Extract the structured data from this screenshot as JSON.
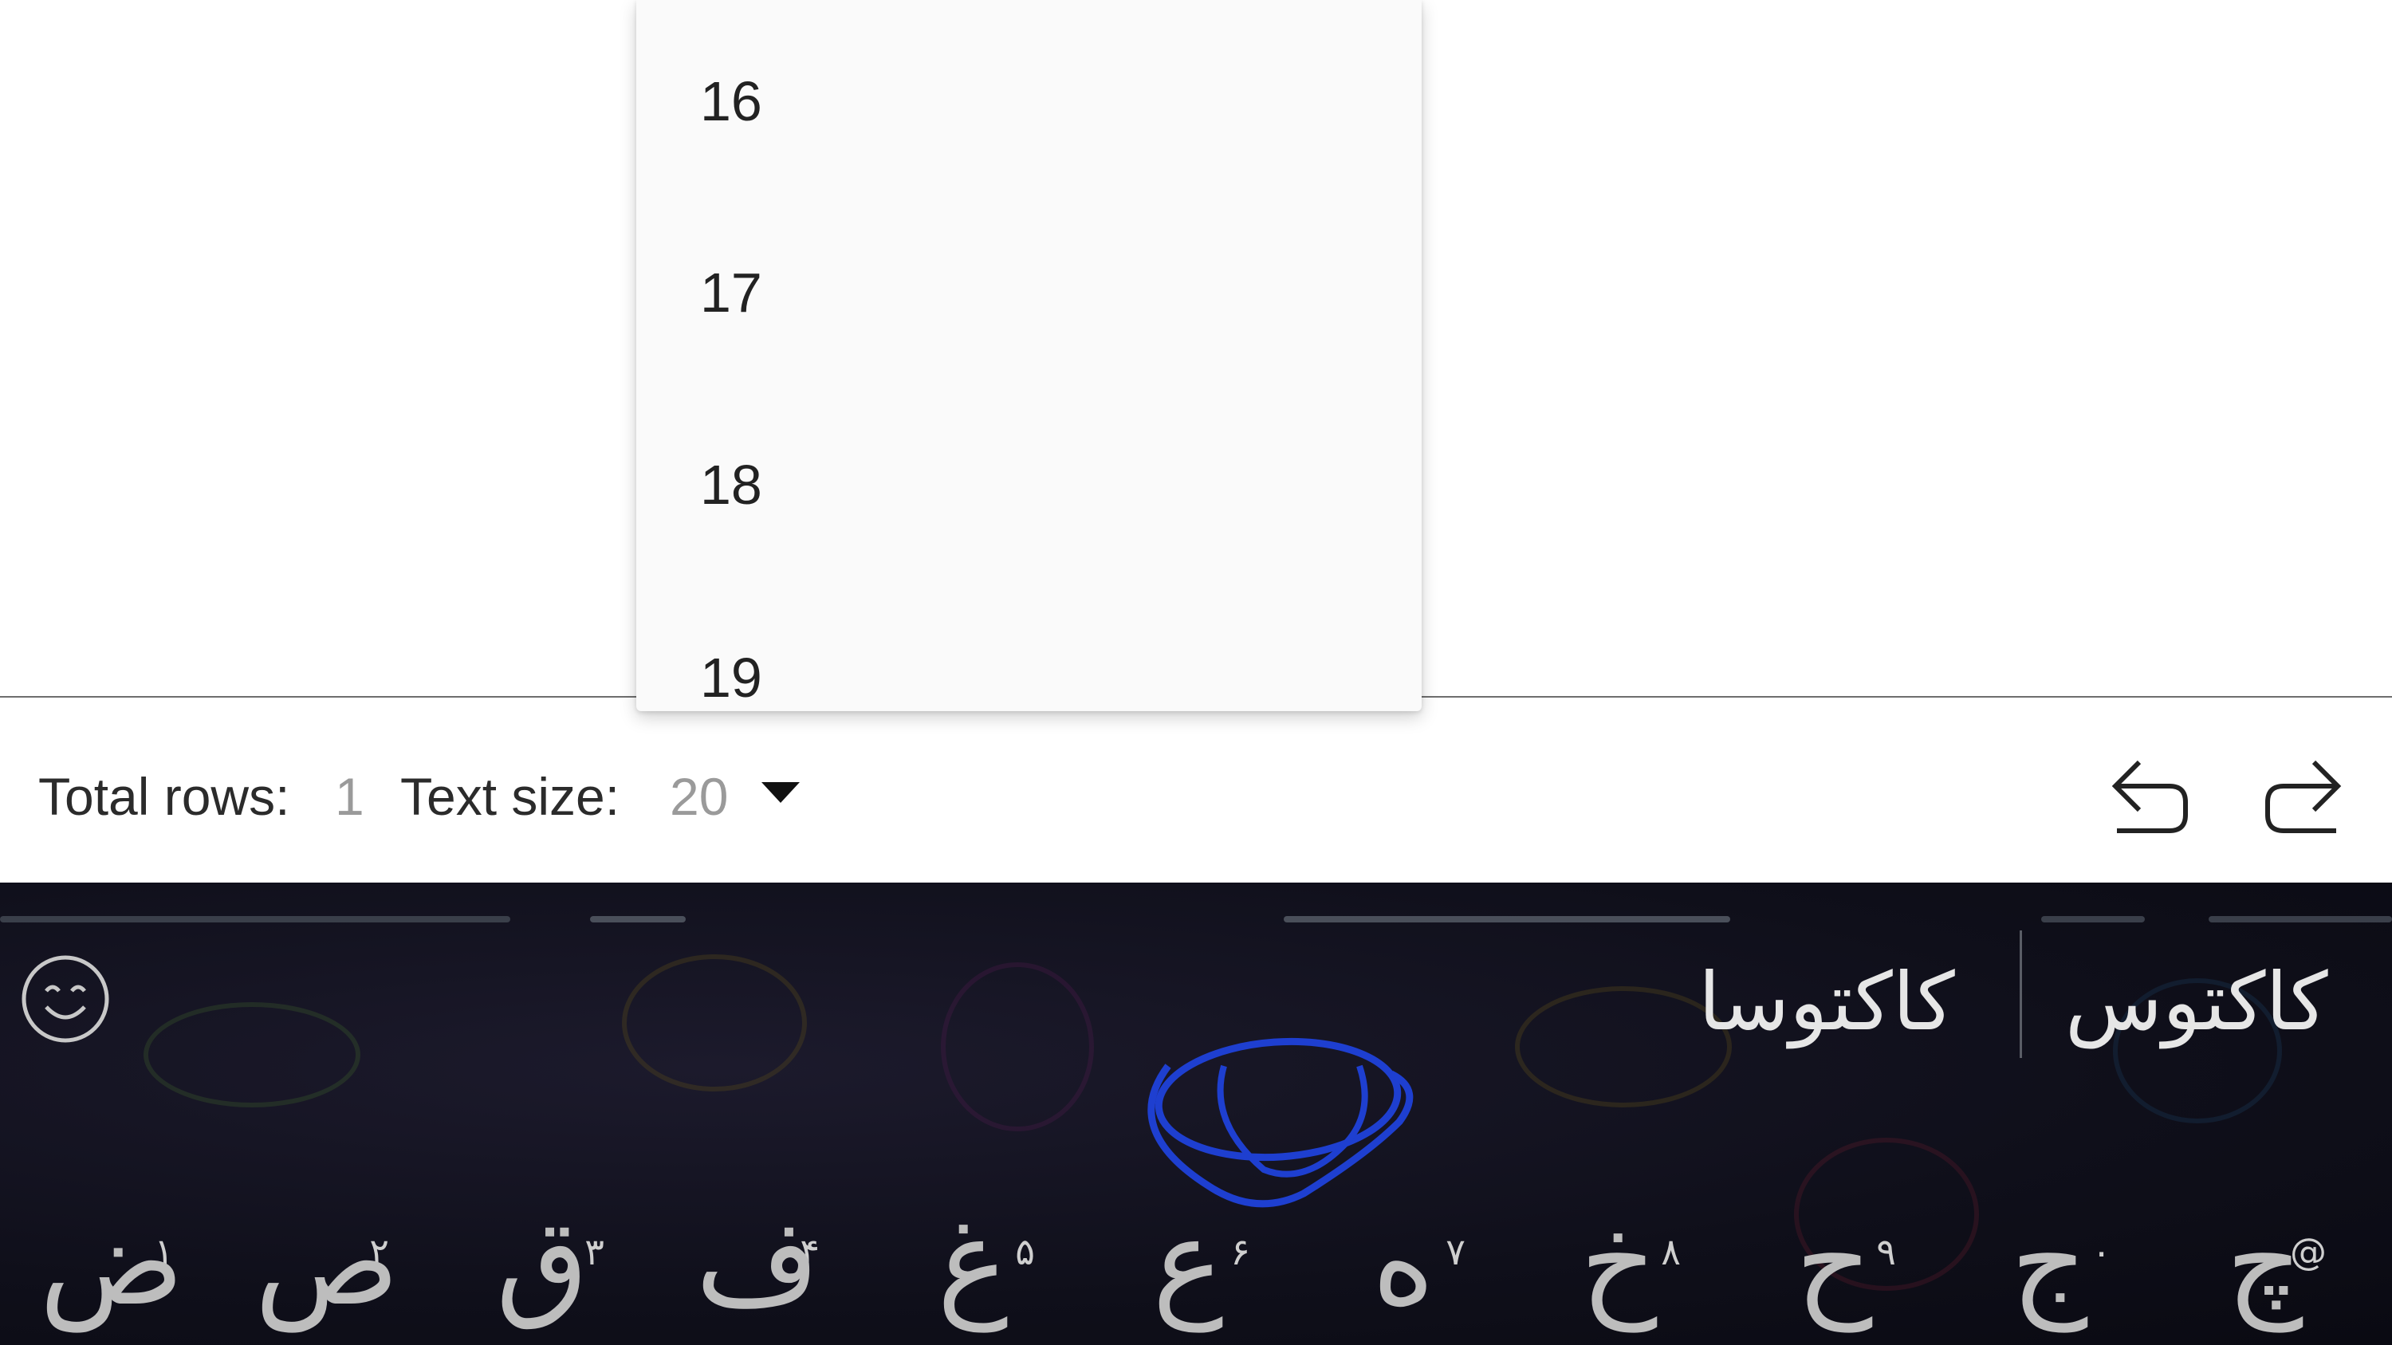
{
  "dropdown": {
    "items": [
      "16",
      "17",
      "18",
      "19"
    ]
  },
  "status": {
    "total_rows_label": "Total rows:",
    "total_rows_value": "1",
    "text_size_label": "Text size:",
    "text_size_value": "20"
  },
  "toolbar": {
    "undo_icon": "undo-icon",
    "redo_icon": "redo-icon"
  },
  "keyboard": {
    "suggestions": [
      "کاکتوس",
      "کاکتوسا"
    ],
    "keys": [
      {
        "main": "ض",
        "hint": "۱"
      },
      {
        "main": "ص",
        "hint": "۲"
      },
      {
        "main": "ق",
        "hint": "۳"
      },
      {
        "main": "ف",
        "hint": "۴"
      },
      {
        "main": "غ",
        "hint": "۵"
      },
      {
        "main": "ع",
        "hint": "۶"
      },
      {
        "main": "ه",
        "hint": "۷"
      },
      {
        "main": "خ",
        "hint": "۸"
      },
      {
        "main": "ح",
        "hint": "۹"
      },
      {
        "main": "ج",
        "hint": "۰"
      },
      {
        "main": "چ",
        "hint": "@"
      }
    ],
    "emoji_icon": "smiley-icon",
    "globe_icon": "globe-icon"
  },
  "colors": {
    "keyboard_bg": "#0f0f1a",
    "globe_blue": "#1e3fd0",
    "muted_value": "#9a9a9a"
  }
}
